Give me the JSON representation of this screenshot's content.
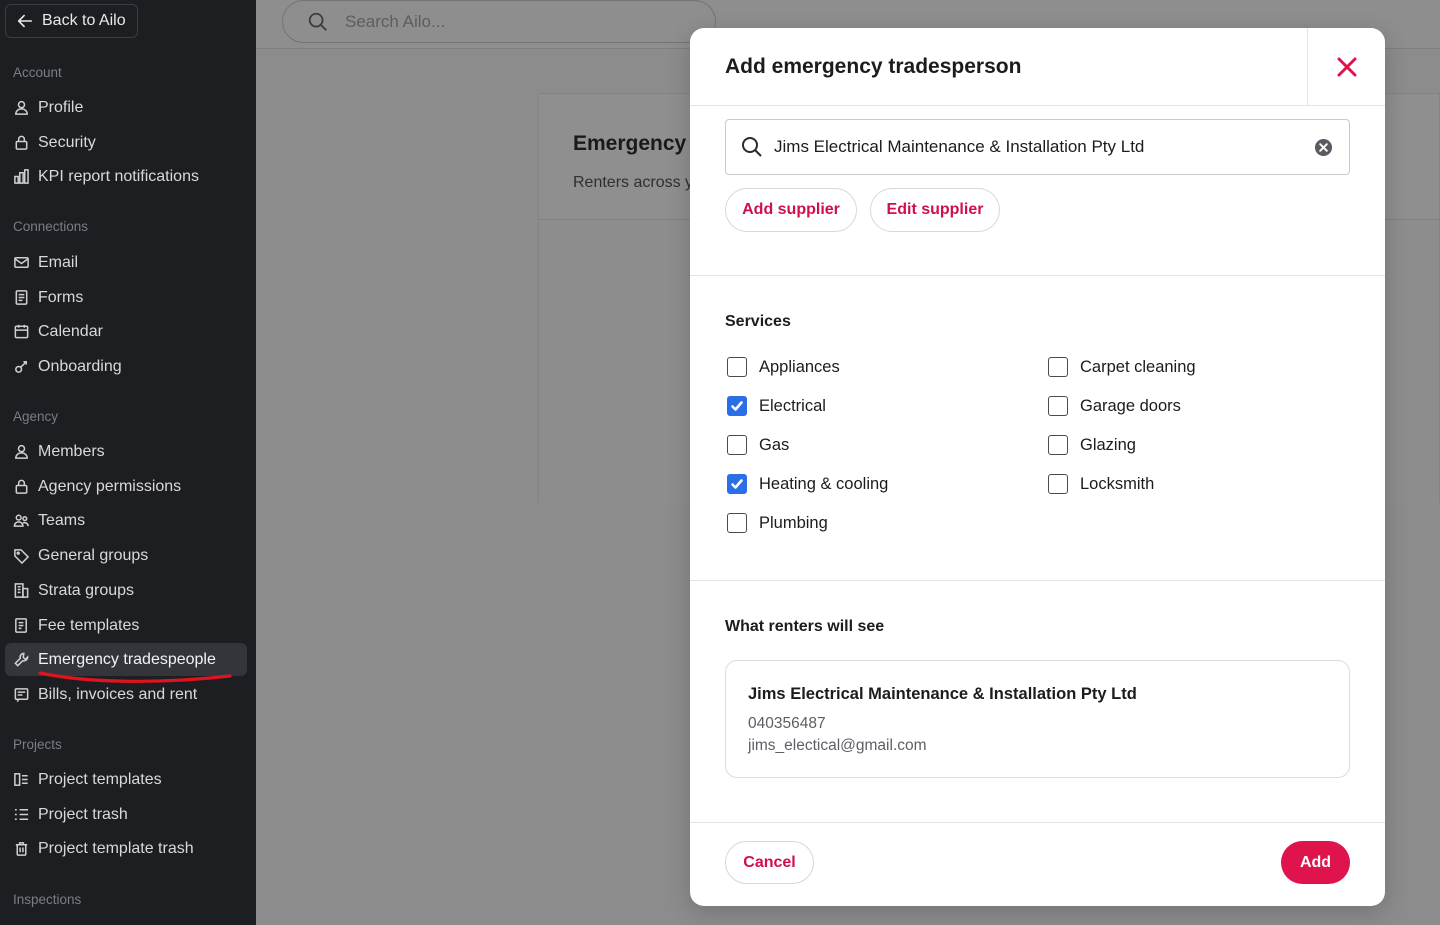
{
  "sidebar": {
    "back_label": "Back to Ailo",
    "sections": [
      {
        "title": "Account",
        "items": [
          {
            "label": "Profile",
            "icon": "person-icon"
          },
          {
            "label": "Security",
            "icon": "lock-icon"
          },
          {
            "label": "KPI report notifications",
            "icon": "bar-chart-icon"
          }
        ]
      },
      {
        "title": "Connections",
        "items": [
          {
            "label": "Email",
            "icon": "mail-icon"
          },
          {
            "label": "Forms",
            "icon": "form-icon"
          },
          {
            "label": "Calendar",
            "icon": "calendar-icon"
          },
          {
            "label": "Onboarding",
            "icon": "onboarding-icon"
          }
        ]
      },
      {
        "title": "Agency",
        "items": [
          {
            "label": "Members",
            "icon": "person-icon"
          },
          {
            "label": "Agency permissions",
            "icon": "lock-icon"
          },
          {
            "label": "Teams",
            "icon": "team-icon"
          },
          {
            "label": "General groups",
            "icon": "tag-icon"
          },
          {
            "label": "Strata groups",
            "icon": "building-icon"
          },
          {
            "label": "Fee templates",
            "icon": "fee-doc-icon"
          },
          {
            "label": "Emergency tradespeople",
            "icon": "wrench-icon",
            "active": true
          },
          {
            "label": "Bills, invoices and rent",
            "icon": "invoice-icon"
          }
        ]
      },
      {
        "title": "Projects",
        "items": [
          {
            "label": "Project templates",
            "icon": "template-icon"
          },
          {
            "label": "Project trash",
            "icon": "list-icon"
          },
          {
            "label": "Project template trash",
            "icon": "trash-icon"
          }
        ]
      },
      {
        "title": "Inspections",
        "items": []
      }
    ]
  },
  "topbar": {
    "search_placeholder": "Search Ailo..."
  },
  "background_card": {
    "title": "Emergency",
    "subtitle": "Renters across y"
  },
  "modal": {
    "title": "Add emergency tradesperson",
    "supplier_value": "Jims Electrical Maintenance & Installation Pty Ltd",
    "add_supplier_label": "Add supplier",
    "edit_supplier_label": "Edit supplier",
    "services_label": "Services",
    "services_left": [
      {
        "label": "Appliances",
        "checked": false
      },
      {
        "label": "Electrical",
        "checked": true
      },
      {
        "label": "Gas",
        "checked": false
      },
      {
        "label": "Heating & cooling",
        "checked": true
      },
      {
        "label": "Plumbing",
        "checked": false
      }
    ],
    "services_right": [
      {
        "label": "Carpet cleaning",
        "checked": false
      },
      {
        "label": "Garage doors",
        "checked": false
      },
      {
        "label": "Glazing",
        "checked": false
      },
      {
        "label": "Locksmith",
        "checked": false
      }
    ],
    "preview_label": "What renters will see",
    "preview": {
      "name": "Jims Electrical Maintenance & Installation Pty Ltd",
      "phone": "040356487",
      "email": "jims_electical@gmail.com"
    },
    "cancel_label": "Cancel",
    "add_label": "Add"
  },
  "colors": {
    "accent": "#e0144c",
    "checkbox": "#2a6ee8",
    "sidebar_bg": "#1d1e22",
    "annotation": "#e0141e"
  }
}
